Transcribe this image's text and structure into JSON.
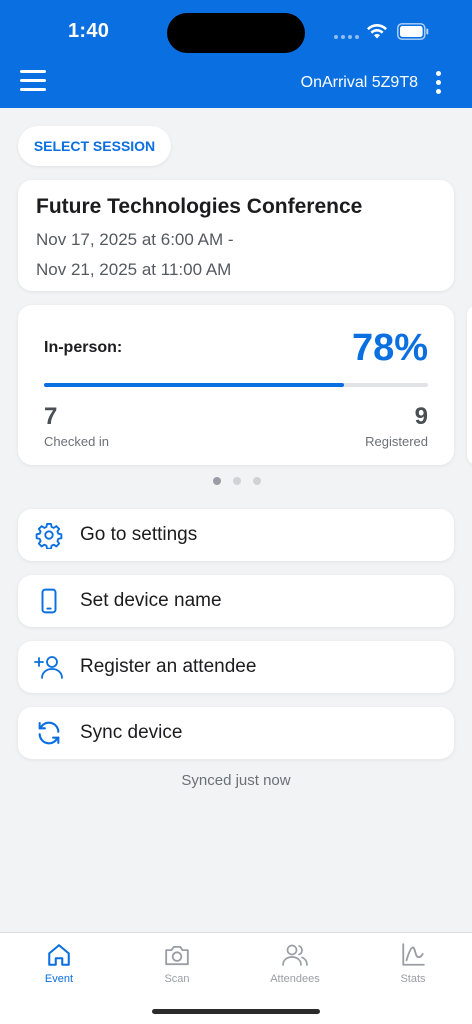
{
  "status_bar": {
    "time": "1:40"
  },
  "header": {
    "title": "OnArrival 5Z9T8",
    "menu_icon": "hamburger-menu-icon",
    "more_icon": "more-vertical-icon"
  },
  "select_session": {
    "label": "SELECT SESSION"
  },
  "event": {
    "name": "Future Technologies Conference",
    "date_line_1": "Nov 17, 2025 at 6:00 AM -",
    "date_line_2": "Nov 21, 2025 at 11:00 AM"
  },
  "stats": {
    "label": "In-person:",
    "percent_text": "78%",
    "progress_fraction": 0.78,
    "checked_in_count": "7",
    "checked_in_label": "Checked in",
    "registered_count": "9",
    "registered_label": "Registered",
    "page_count": 3,
    "active_page": 1
  },
  "actions": [
    {
      "label": "Go to settings",
      "icon": "gear-icon"
    },
    {
      "label": "Set device name",
      "icon": "phone-icon"
    },
    {
      "label": "Register an attendee",
      "icon": "add-person-icon"
    },
    {
      "label": "Sync device",
      "icon": "sync-icon"
    }
  ],
  "sync_status": "Synced just now",
  "tabs": [
    {
      "label": "Event",
      "icon": "home-icon",
      "active": true
    },
    {
      "label": "Scan",
      "icon": "camera-icon",
      "active": false
    },
    {
      "label": "Attendees",
      "icon": "people-icon",
      "active": false
    },
    {
      "label": "Stats",
      "icon": "chart-icon",
      "active": false
    }
  ],
  "colors": {
    "accent": "#0a6fe0",
    "background": "#f2f3f5",
    "inactive_tab": "#9a9ea4"
  }
}
